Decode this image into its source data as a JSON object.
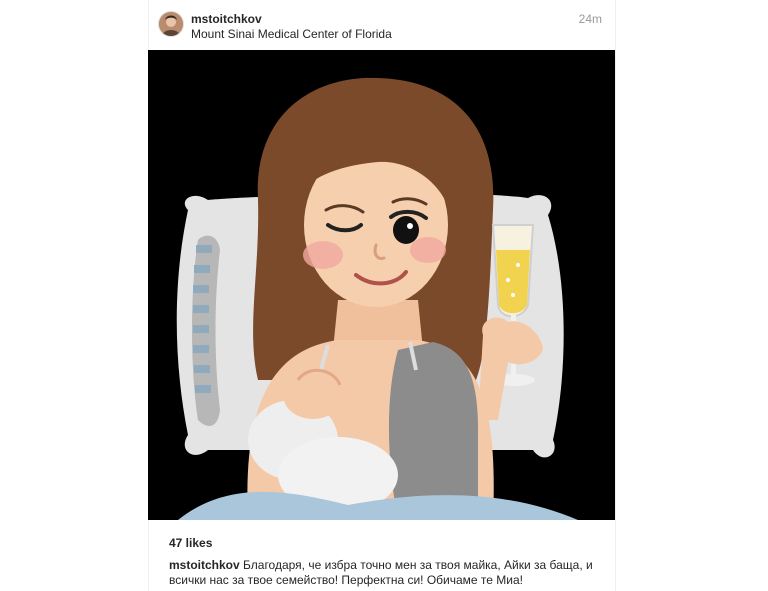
{
  "post": {
    "username": "mstoitchkov",
    "location": "Mount Sinai Medical Center of Florida",
    "timestamp": "24m",
    "likes": "47 likes",
    "caption_user": "mstoitchkov",
    "caption_text": "Благодаря, че избра точно мен за твоя майка, Айки за баща, и всички нас за твое семейство! Перфектна си! Обичаме те Миа!"
  },
  "colors": {
    "photo_background": "#000000",
    "hair": "#7a4a2a",
    "skin": "#f4c9a8",
    "blanket": "#a9c6db",
    "pillow": "#e6e6e6",
    "champagne": "#f2d34f"
  }
}
